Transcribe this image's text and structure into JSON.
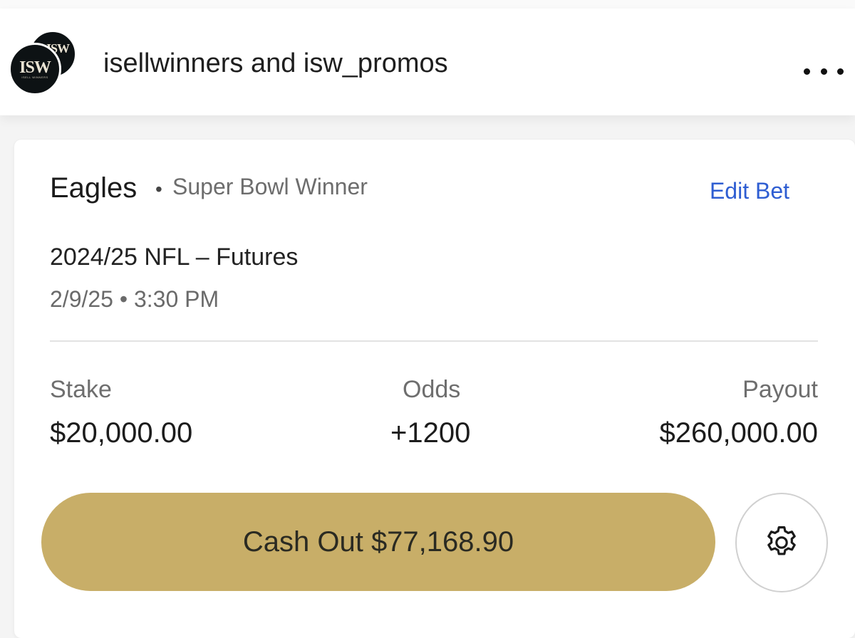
{
  "header": {
    "avatar_primary_text": "ISW",
    "avatar_primary_tag": "ISELL WINNERS",
    "avatar_secondary_text": "ISW",
    "title": "isellwinners and isw_promos",
    "more_icon": "more-horizontal-icon"
  },
  "bet": {
    "team": "Eagles",
    "separator": "•",
    "market": "Super Bowl Winner",
    "edit_label": "Edit Bet",
    "event": "2024/25 NFL – Futures",
    "datetime": "2/9/25 • 3:30 PM",
    "stake_label": "Stake",
    "stake_value": "$20,000.00",
    "odds_label": "Odds",
    "odds_value": "+1200",
    "payout_label": "Payout",
    "payout_value": "$260,000.00",
    "cashout_label": "Cash Out $77,168.90",
    "settings_icon": "gear-icon"
  },
  "colors": {
    "accent_link": "#2f5ed2",
    "cashout_button": "#c8ae68",
    "text_primary": "#1c1c1c",
    "text_secondary": "#6d6d6d"
  }
}
